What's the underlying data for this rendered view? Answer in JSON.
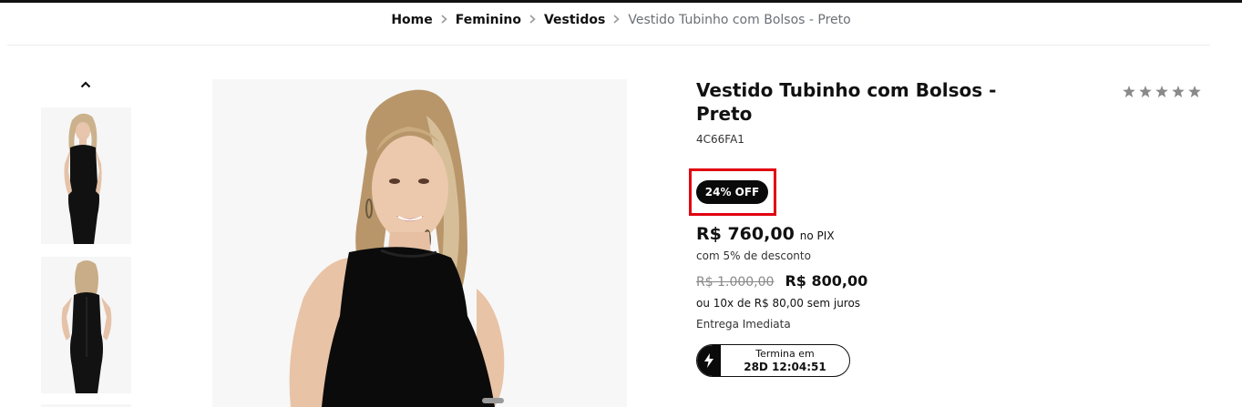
{
  "breadcrumb": {
    "home": "Home",
    "category": "Feminino",
    "subcategory": "Vestidos",
    "current": "Vestido Tubinho com Bolsos - Preto"
  },
  "icons": {
    "separator": "chevron-right-icon",
    "gallery_up": "chevron-up-icon",
    "rating": "star-icon",
    "timer": "lightning-bolt-icon"
  },
  "product": {
    "title": "Vestido Tubinho com Bolsos - Preto",
    "sku": "4C66FA1",
    "rating_stars": 5,
    "discount_badge": "24% OFF",
    "pix_price": "R$ 760,00",
    "pix_label": "no PIX",
    "pix_discount": "com 5% de desconto",
    "old_price": "R$ 1.000,00",
    "price": "R$ 800,00",
    "installments": "ou 10x de R$ 80,00 sem juros",
    "delivery": "Entrega Imediata",
    "timer_label": "Termina em",
    "timer_value": "28D 12:04:51"
  },
  "colors": {
    "accent": "#111111",
    "highlight": "#e10010",
    "star": "#8a8a8a"
  }
}
